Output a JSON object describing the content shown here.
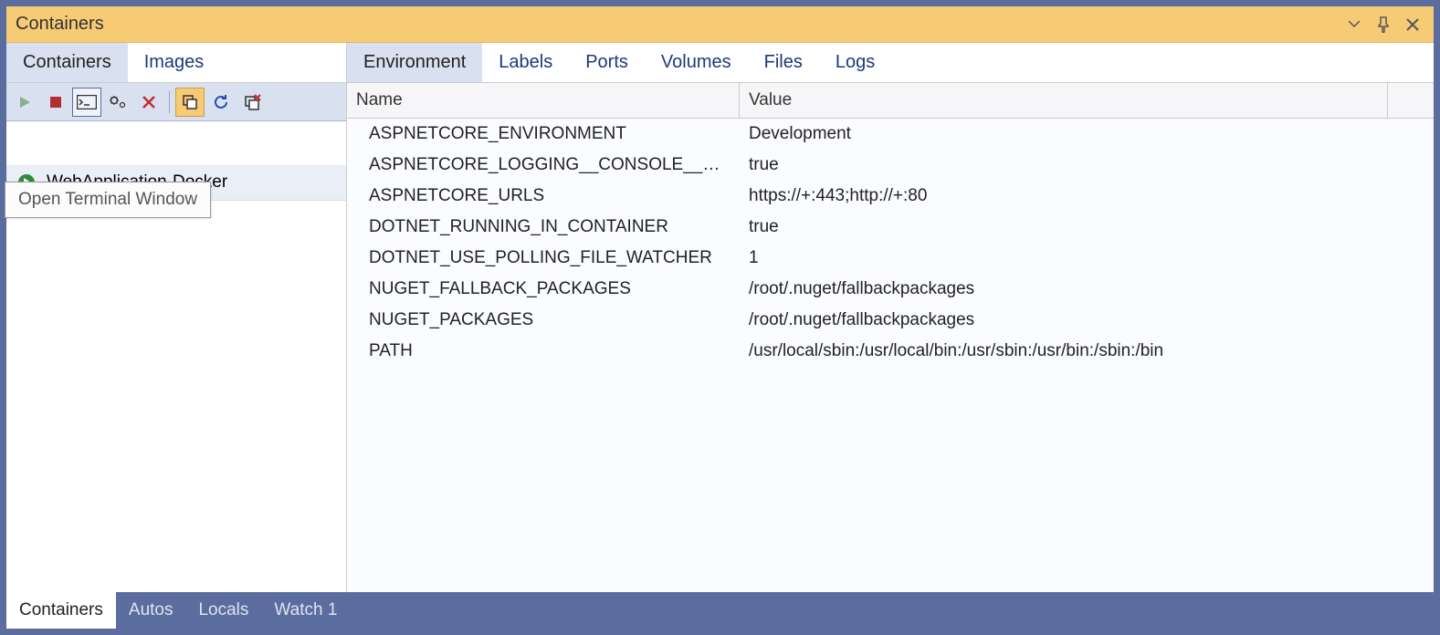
{
  "window": {
    "title": "Containers"
  },
  "left": {
    "tabs": [
      "Containers",
      "Images"
    ],
    "tooltip": "Open Terminal Window",
    "container_name": "WebApplication-Docker"
  },
  "detail": {
    "tabs": [
      "Environment",
      "Labels",
      "Ports",
      "Volumes",
      "Files",
      "Logs"
    ],
    "columns": {
      "name": "Name",
      "value": "Value"
    },
    "rows": [
      {
        "name": "ASPNETCORE_ENVIRONMENT",
        "value": "Development"
      },
      {
        "name": "ASPNETCORE_LOGGING__CONSOLE__DISA...",
        "value": "true"
      },
      {
        "name": "ASPNETCORE_URLS",
        "value": "https://+:443;http://+:80"
      },
      {
        "name": "DOTNET_RUNNING_IN_CONTAINER",
        "value": "true"
      },
      {
        "name": "DOTNET_USE_POLLING_FILE_WATCHER",
        "value": "1"
      },
      {
        "name": "NUGET_FALLBACK_PACKAGES",
        "value": "/root/.nuget/fallbackpackages"
      },
      {
        "name": "NUGET_PACKAGES",
        "value": "/root/.nuget/fallbackpackages"
      },
      {
        "name": "PATH",
        "value": "/usr/local/sbin:/usr/local/bin:/usr/sbin:/usr/bin:/sbin:/bin"
      }
    ]
  },
  "bottom": {
    "tabs": [
      "Containers",
      "Autos",
      "Locals",
      "Watch 1"
    ]
  }
}
